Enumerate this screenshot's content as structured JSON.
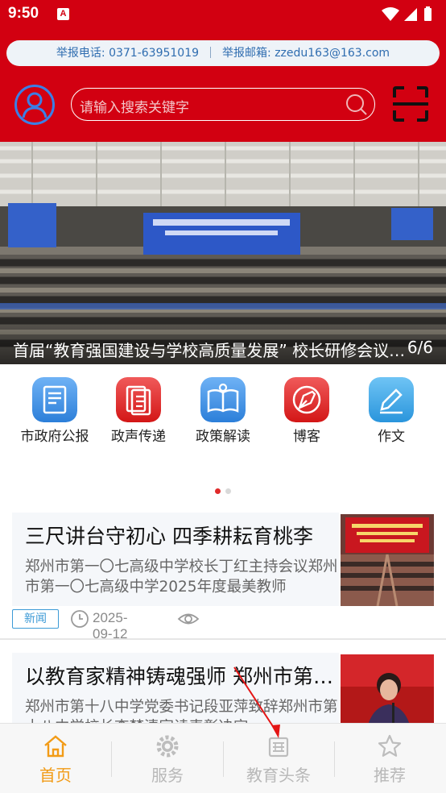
{
  "status_bar": {
    "time": "9:50",
    "notification_badge": "A"
  },
  "header": {
    "hotline_phone": "举报电话: 0371-63951019",
    "hotline_email": "举报邮箱: zzedu163@163.com",
    "search_placeholder": "请输入搜索关键字"
  },
  "banner": {
    "caption": "首届“教育强国建设与学校高质量发展” 校长研修会议召开",
    "counter": "6/6"
  },
  "quick_links": [
    {
      "label": "市政府公报",
      "icon": "gazette-icon",
      "color": "#3b8fe0"
    },
    {
      "label": "政声传递",
      "icon": "document-icon",
      "color": "#e02a2a"
    },
    {
      "label": "政策解读",
      "icon": "open-book-icon",
      "color": "#3b8fe0"
    },
    {
      "label": "博客",
      "icon": "pen-nib-icon",
      "color": "#e02a2a"
    },
    {
      "label": "作文",
      "icon": "pencil-icon",
      "color": "#3b8fe0"
    }
  ],
  "news": [
    {
      "title": "三尺讲台守初心 四季耕耘育桃李",
      "summary": "郑州市第一〇七高级中学校长丁红主持会议郑州市第一〇七高级中学2025年度最美教师",
      "tag": "新闻",
      "date": "2025-09-12"
    },
    {
      "title": "以教育家精神铸魂强师 郑州市第十八中学",
      "summary": "郑州市第十八中学党委书记段亚萍致辞郑州市第十八中学校长李梦清宣读表彰决定"
    }
  ],
  "bottom_nav": [
    {
      "label": "首页",
      "icon": "home-icon",
      "active": true
    },
    {
      "label": "服务",
      "icon": "gear-icon",
      "active": false
    },
    {
      "label": "教育头条",
      "icon": "newspaper-icon",
      "active": false
    },
    {
      "label": "推荐",
      "icon": "star-icon",
      "active": false
    }
  ],
  "colors": {
    "brand_red": "#d20011",
    "accent_orange": "#f29b16",
    "tag_blue": "#3c9ad6"
  }
}
